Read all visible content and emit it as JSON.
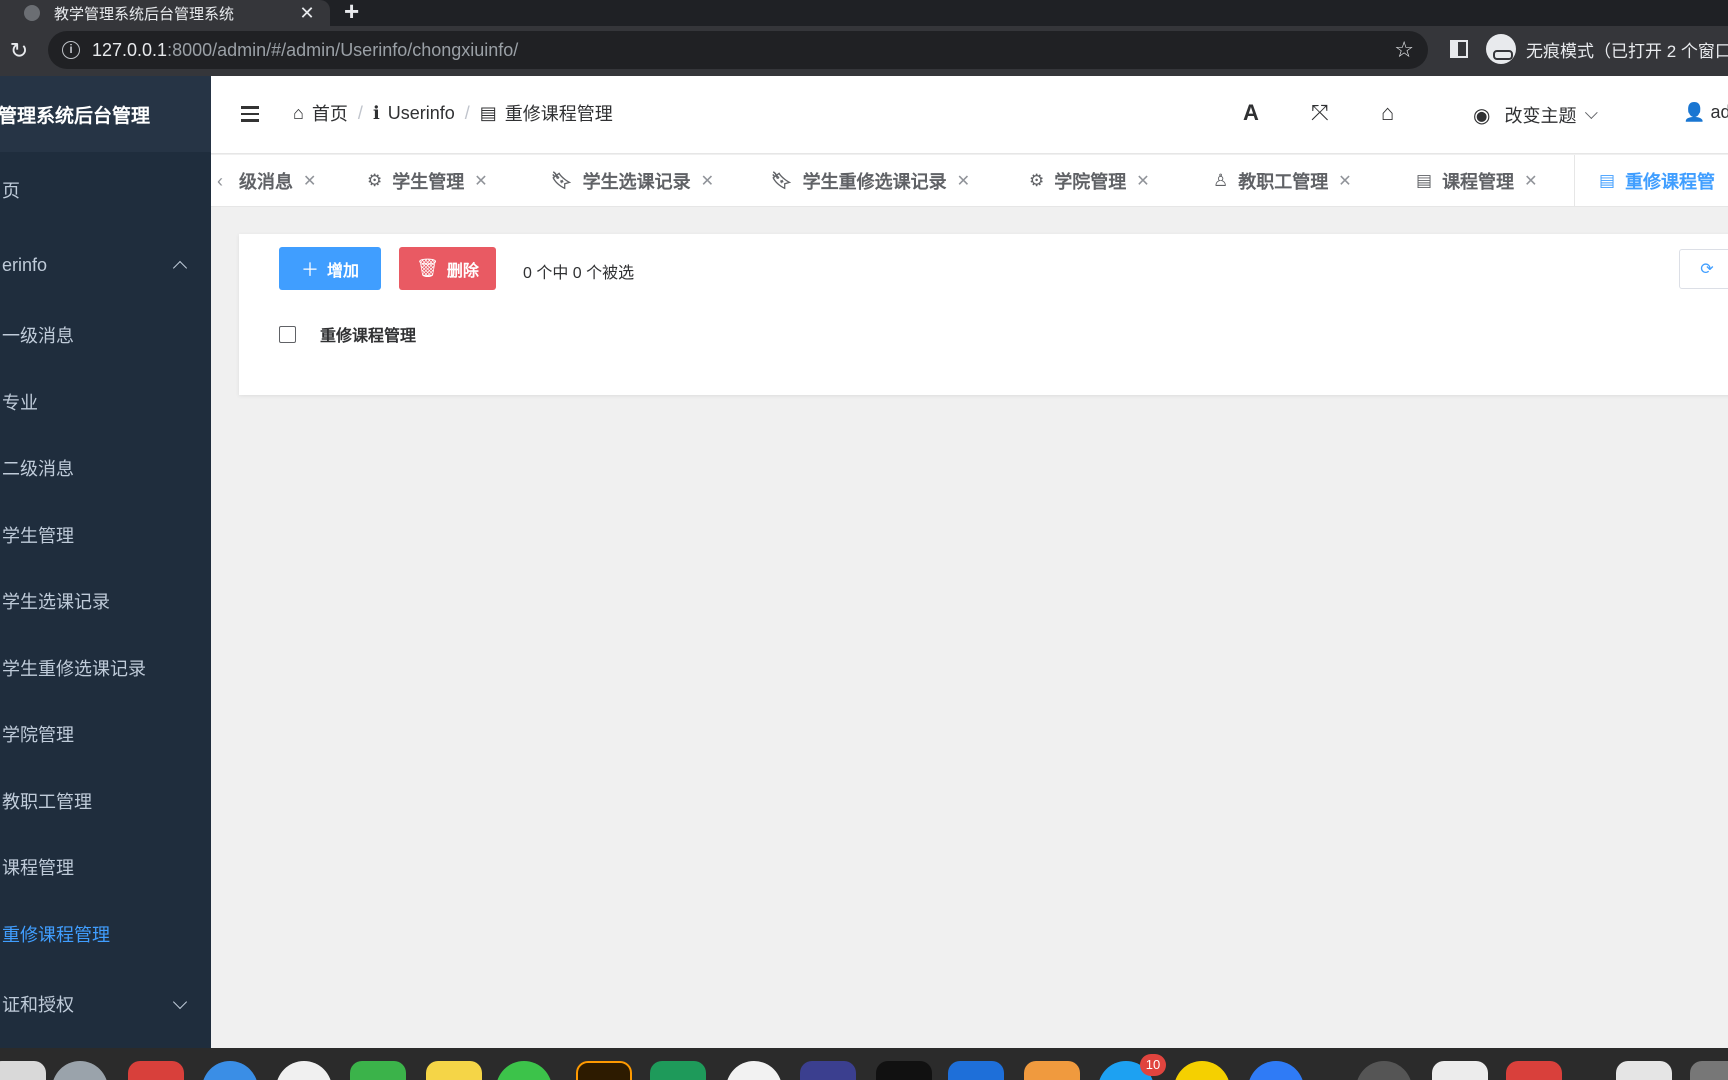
{
  "browser": {
    "tab_title": "教学管理系统后台管理系统",
    "tab_close": "✕",
    "new_tab": "+",
    "url_host": "127.0.0.1",
    "url_rest": ":8000/admin/#/admin/Userinfo/chongxiuinfo/",
    "incognito_label": "无痕模式（已打开 2 个窗口"
  },
  "sidebar": {
    "brand": "管理系统后台管理",
    "home": "页",
    "userinfo_group": "erinfo",
    "items": [
      {
        "label": "一级消息"
      },
      {
        "label": "专业"
      },
      {
        "label": "二级消息"
      },
      {
        "label": "学生管理"
      },
      {
        "label": "学生选课记录"
      },
      {
        "label": "学生重修选课记录"
      },
      {
        "label": "学院管理"
      },
      {
        "label": "教职工管理"
      },
      {
        "label": "课程管理"
      },
      {
        "label": "重修课程管理"
      }
    ],
    "auth_group": "证和授权"
  },
  "header": {
    "breadcrumb": [
      "首页",
      "Userinfo",
      "重修课程管理"
    ],
    "theme_label": "改变主题",
    "user_label": "ad"
  },
  "tags": [
    {
      "label": "级消息",
      "icon": "none"
    },
    {
      "label": "学生管理",
      "icon": "gear-icon"
    },
    {
      "label": "学生选课记录",
      "icon": "bookmark-icon"
    },
    {
      "label": "学生重修选课记录",
      "icon": "bookmark-icon"
    },
    {
      "label": "学院管理",
      "icon": "gear-icon"
    },
    {
      "label": "教职工管理",
      "icon": "user-icon"
    },
    {
      "label": "课程管理",
      "icon": "book-icon"
    },
    {
      "label": "重修课程管",
      "icon": "book-icon",
      "active": true
    }
  ],
  "content": {
    "add_label": "增加",
    "delete_label": "删除",
    "selection_text": "0 个中 0 个被选",
    "row_label": "重修课程管理"
  },
  "dock": {
    "badge_count": "10"
  },
  "colors": {
    "primary": "#409eff",
    "danger": "#e95a63",
    "sidebar_bg": "#1f2d3d"
  }
}
